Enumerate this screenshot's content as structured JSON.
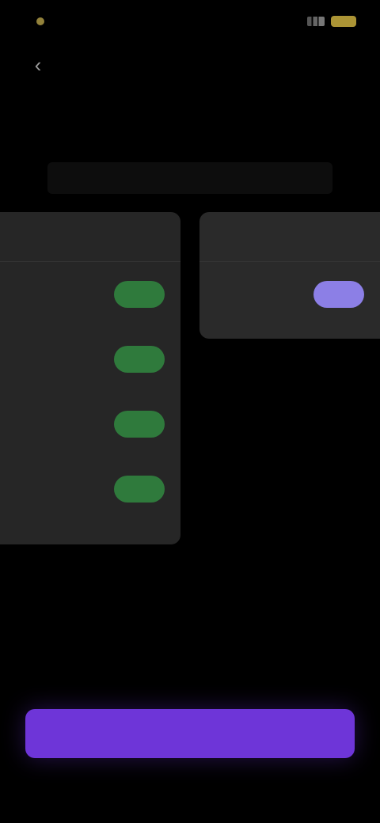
{
  "status": {
    "time": "",
    "icons": [
      "signal-icon",
      "battery-icon"
    ]
  },
  "nav": {
    "back_icon": "chevron-left-icon",
    "back_glyph": "‹"
  },
  "header": {
    "title": "",
    "subtitle": ""
  },
  "left_card": {
    "title": "",
    "rows": [
      {
        "label": "",
        "button": ""
      },
      {
        "label": "",
        "button": ""
      },
      {
        "label": "",
        "button": ""
      },
      {
        "label": "",
        "button": ""
      }
    ]
  },
  "right_card": {
    "title": "",
    "rows": [
      {
        "label": "",
        "button": ""
      }
    ]
  },
  "footer": {
    "secondary_link": "",
    "primary_button": ""
  },
  "colors": {
    "accent_purple": "#6e35d8",
    "accent_green": "#2f7a3c",
    "chip_purple": "#8c7fe6",
    "background": "#000000",
    "card": "#262626"
  }
}
